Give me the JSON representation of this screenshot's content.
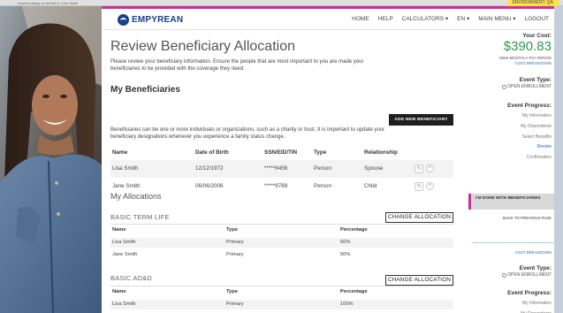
{
  "env": {
    "left_text": "Impersonating on behalf of John Smith",
    "right_text": "ENVIRONMENT: QA"
  },
  "navbar": {
    "logo_text": "EMPYREAN",
    "links": [
      "HOME",
      "HELP",
      "CALCULATORS ▾",
      "EN ▾",
      "MAIN MENU ▾",
      "LOGOUT"
    ]
  },
  "page": {
    "title": "Review Beneficiary Allocation",
    "intro": "Please review your beneficiary information. Ensure the people that are most important to you are made your beneficiaries to be provided with the coverage they need."
  },
  "beneficiaries": {
    "heading": "My Beneficiaries",
    "add_button": "ADD NEW BENEFICIARY",
    "note": "Beneficiaries can be one or more individuals or organizations, such as a charity or trust. It is important to update your beneficiary designations whenever you experience a family status change.",
    "columns": [
      "Name",
      "Date of Birth",
      "SSN/EID/TIN",
      "Type",
      "Relationship"
    ],
    "rows": [
      [
        "Lisa Smith",
        "12/12/1972",
        "*****6456",
        "Person",
        "Spouse"
      ],
      [
        "Jane Smith",
        "06/06/2006",
        "*****9789",
        "Person",
        "Child"
      ]
    ]
  },
  "allocations": {
    "heading": "My Allocations",
    "change_label": "CHANGE ALLOCATION",
    "columns": [
      "Name",
      "Type",
      "Percentage"
    ],
    "plans": [
      {
        "title": "BASIC TERM LIFE",
        "rows": [
          [
            "Lisa Smith",
            "Primary",
            "50%"
          ],
          [
            "Jane Smith",
            "Primary",
            "50%"
          ]
        ]
      },
      {
        "title": "BASIC AD&D",
        "rows": [
          [
            "Lisa Smith",
            "Primary",
            "100%"
          ]
        ]
      }
    ]
  },
  "sidebar": {
    "cost_label": "Your Cost:",
    "cost_value": "$390.83",
    "pay_period": "SEMI-MONTHLY PAY PERIOD",
    "cost_link": "COST BREAKDOWN",
    "event_type_label": "Event Type:",
    "event_type_value": "OPEN ENROLLMENT",
    "progress_label": "Event Progress:",
    "steps": [
      "My Information",
      "My Dependents",
      "Select Benefits",
      "Review",
      "Confirmation"
    ],
    "active_step": "Review",
    "done_button": "I'M DONE WITH BENEFICIARIES",
    "back_link": "BACK TO PREVIOUS PAGE"
  },
  "colors": {
    "accent": "#d42a9a",
    "brand": "#1b3f8b",
    "cost": "#2f9a4f",
    "link": "#2a6ebb"
  }
}
